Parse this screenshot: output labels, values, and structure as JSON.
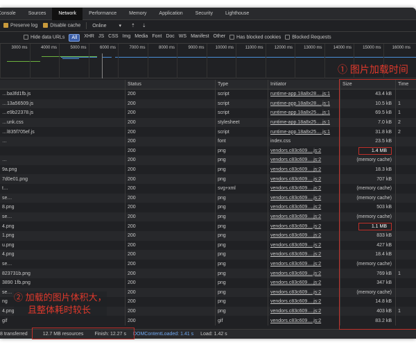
{
  "tabs": [
    "Console",
    "Sources",
    "Network",
    "Performance",
    "Memory",
    "Application",
    "Security",
    "Lighthouse"
  ],
  "active_tab": "Network",
  "toolbar": {
    "preserve_log": "Preserve log",
    "disable_cache": "Disable cache",
    "throttle": "Online",
    "throttle_caret": "▾",
    "upload_icon": "⇡",
    "download_icon": "⇣"
  },
  "filters": {
    "hide_data_urls": "Hide data URLs",
    "types": [
      "All",
      "XHR",
      "JS",
      "CSS",
      "Img",
      "Media",
      "Font",
      "Doc",
      "WS",
      "Manifest",
      "Other"
    ],
    "has_blocked_cookies": "Has blocked cookies",
    "blocked_requests": "Blocked Requests"
  },
  "timeline_ticks": [
    "3000 ms",
    "4000 ms",
    "5000 ms",
    "6000 ms",
    "7000 ms",
    "8000 ms",
    "9000 ms",
    "10000 ms",
    "11000 ms",
    "12000 ms",
    "13000 ms",
    "14000 ms",
    "15000 ms",
    "16000 ms"
  ],
  "columns": {
    "name": "",
    "status": "Status",
    "type": "Type",
    "initiator": "Initiator",
    "size": "Size",
    "time": "Time"
  },
  "rows": [
    {
      "name": "…ba3fd1fb.js",
      "status": "200",
      "type": "script",
      "initiator": "runtime-app.18a8x28….js:1",
      "link": true,
      "size": "43.4 kB",
      "time": ""
    },
    {
      "name": "…13a56509.js",
      "status": "200",
      "type": "script",
      "initiator": "runtime-app.18a8x28….js:1",
      "link": true,
      "size": "10.5 kB",
      "time": "1"
    },
    {
      "name": "…e9b22378.js",
      "status": "200",
      "type": "script",
      "initiator": "runtime-app.18a8x25….js:1",
      "link": true,
      "size": "69.5 kB",
      "time": "1"
    },
    {
      "name": "…unk.css",
      "status": "200",
      "type": "stylesheet",
      "initiator": "runtime-app.18a8x25….js:1",
      "link": true,
      "size": "7.0 kB",
      "time": "2"
    },
    {
      "name": "…l835f705ef.js",
      "status": "200",
      "type": "script",
      "initiator": "runtime-app.18a8x25….js:1",
      "link": true,
      "size": "31.8 kB",
      "time": "2"
    },
    {
      "name": "…",
      "status": "200",
      "type": "font",
      "initiator": "index.css",
      "link": false,
      "size": "23.5 kB",
      "time": ""
    },
    {
      "name": "",
      "status": "200",
      "type": "png",
      "initiator": "vendors.c83c609….js:2",
      "link": true,
      "size": "1.4 MB",
      "time": "",
      "boxed": true
    },
    {
      "name": "…",
      "status": "200",
      "type": "png",
      "initiator": "vendors.c83c609….js:2",
      "link": true,
      "size": "(memory cache)",
      "time": ""
    },
    {
      "name": "9a.png",
      "status": "200",
      "type": "png",
      "initiator": "vendors.c83c609….js:2",
      "link": true,
      "size": "18.3 kB",
      "time": ""
    },
    {
      "name": "7d0e01.png",
      "status": "200",
      "type": "png",
      "initiator": "vendors.c83c609….js:2",
      "link": true,
      "size": "707 kB",
      "time": ""
    },
    {
      "name": "t…",
      "status": "200",
      "type": "svg+xml",
      "initiator": "vendors.c83c609….js:2",
      "link": true,
      "size": "(memory cache)",
      "time": ""
    },
    {
      "name": "se…",
      "status": "200",
      "type": "png",
      "initiator": "vendors.c83c609….js:2",
      "link": true,
      "size": "(memory cache)",
      "time": ""
    },
    {
      "name": "8.png",
      "status": "200",
      "type": "png",
      "initiator": "vendors.c83c609….js:2",
      "link": true,
      "size": "503 kB",
      "time": ""
    },
    {
      "name": "se…",
      "status": "200",
      "type": "png",
      "initiator": "vendors.c83c609….js:2",
      "link": true,
      "size": "(memory cache)",
      "time": ""
    },
    {
      "name": "4.png",
      "status": "200",
      "type": "png",
      "initiator": "vendors.c83c609….js:2",
      "link": true,
      "size": "1.1 MB",
      "time": "",
      "boxed": true
    },
    {
      "name": "1.png",
      "status": "200",
      "type": "png",
      "initiator": "vendors.c83c609….js:2",
      "link": true,
      "size": "833 kB",
      "time": ""
    },
    {
      "name": "u.png",
      "status": "200",
      "type": "png",
      "initiator": "vendors.c83c609….js:2",
      "link": true,
      "size": "427 kB",
      "time": ""
    },
    {
      "name": "4.png",
      "status": "200",
      "type": "png",
      "initiator": "vendors.c83c609….js:2",
      "link": true,
      "size": "18.4 kB",
      "time": ""
    },
    {
      "name": "se…",
      "status": "200",
      "type": "png",
      "initiator": "vendors.c83c609….js:2",
      "link": true,
      "size": "(memory cache)",
      "time": ""
    },
    {
      "name": "823731b.png",
      "status": "200",
      "type": "png",
      "initiator": "vendors.c83c609….js:2",
      "link": true,
      "size": "769 kB",
      "time": "1"
    },
    {
      "name": "3890 1fb.png",
      "status": "200",
      "type": "png",
      "initiator": "vendors.c83c609….js:2",
      "link": true,
      "size": "347 kB",
      "time": ""
    },
    {
      "name": "se…",
      "status": "200",
      "type": "png",
      "initiator": "vendors.c83c609….js:2",
      "link": true,
      "size": "(memory cache)",
      "time": ""
    },
    {
      "name": "ng",
      "status": "200",
      "type": "png",
      "initiator": "vendors.c83c609….js:2",
      "link": true,
      "size": "14.8 kB",
      "time": ""
    },
    {
      "name": "4.png",
      "status": "200",
      "type": "png",
      "initiator": "vendors.c83c609….js:2",
      "link": true,
      "size": "403 kB",
      "time": "1"
    },
    {
      "name": "gif",
      "status": "200",
      "type": "gif",
      "initiator": "vendors.c83c609….js:2",
      "link": true,
      "size": "83.2 kB",
      "time": ""
    }
  ],
  "status_bar": {
    "transferred": "8 transferred",
    "resources": "12.7 MB resources",
    "finish": "Finish: 12.27 s",
    "dom_loaded": "DOMContentLoaded: 1.41 s",
    "load": "Load: 1.42 s"
  },
  "annotations": {
    "one": "① 图片加载时间",
    "two_line1": "② 加载的图片体积大，",
    "two_line2": "且整体耗时较长"
  },
  "colors": {
    "annotation": "#e0392c",
    "accent": "#3b5ea8",
    "checkbox": "#c99a3c",
    "dom_loaded": "#6fa8f0"
  }
}
